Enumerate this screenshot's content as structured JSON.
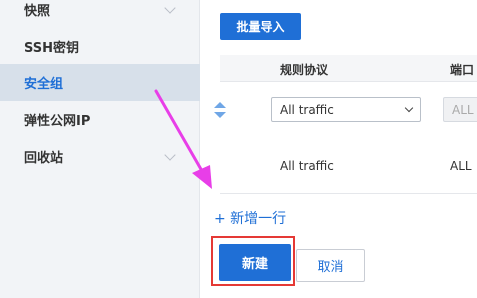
{
  "sidebar": {
    "items": [
      {
        "label": "快照",
        "has_chevron": true,
        "active": false
      },
      {
        "label": "SSH密钥",
        "has_chevron": false,
        "active": false
      },
      {
        "label": "安全组",
        "has_chevron": false,
        "active": true
      },
      {
        "label": "弹性公网IP",
        "has_chevron": false,
        "active": false
      },
      {
        "label": "回收站",
        "has_chevron": true,
        "active": false
      }
    ]
  },
  "main": {
    "batch_import_label": "批量导入",
    "table": {
      "headers": {
        "protocol": "规则协议",
        "port": "端口"
      },
      "edit_row": {
        "protocol_value": "All traffic",
        "port_value": "ALL"
      },
      "static_row": {
        "protocol": "All traffic",
        "port": "ALL"
      }
    },
    "add_row_label": "+ 新增一行",
    "create_label": "新建",
    "cancel_label": "取消"
  },
  "colors": {
    "accent": "#1f6fd6",
    "highlight": "#e53935",
    "arrow": "#e83ee8",
    "sidebar_bg": "#f2f4f7",
    "sidebar_active_bg": "#d7e0ea"
  },
  "icons": {
    "sort": "sort-updown-icon",
    "chevron": "chevron-down-icon",
    "select_caret": "caret-down-icon",
    "annotation": "magenta-arrow"
  }
}
